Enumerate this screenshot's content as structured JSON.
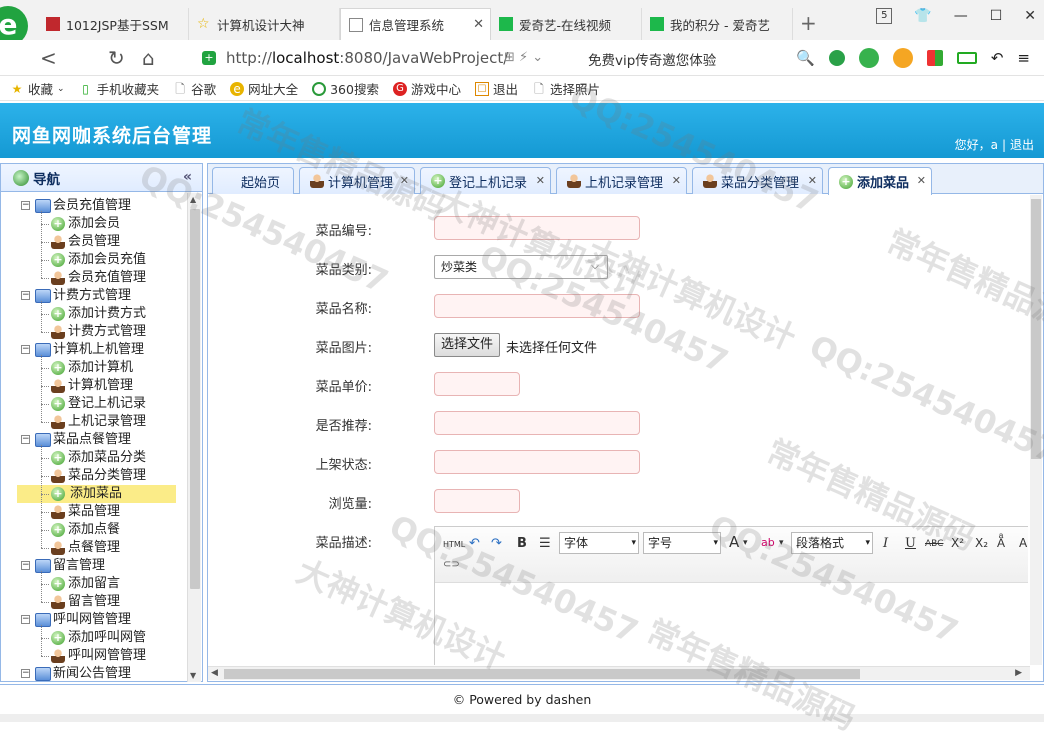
{
  "browser": {
    "tabs": [
      {
        "title": "1012JSP基于SSM",
        "active": false
      },
      {
        "title": "计算机设计大神",
        "active": false
      },
      {
        "title": "信息管理系统",
        "active": true
      },
      {
        "title": "爱奇艺-在线视频",
        "active": false
      },
      {
        "title": "我的积分 - 爱奇艺",
        "active": false
      }
    ],
    "tab_counter": "5",
    "url_prefix": "http://",
    "url_host": "localhost",
    "url_rest": ":8080/JavaWebProject/",
    "promo": "免费vip传奇邀您体验"
  },
  "bookmarks": [
    {
      "label": "收藏",
      "icon": "star-icon"
    },
    {
      "label": "手机收藏夹",
      "icon": "phone-icon"
    },
    {
      "label": "谷歌",
      "icon": "page-icon"
    },
    {
      "label": "网址大全",
      "icon": "globe-icon"
    },
    {
      "label": "360搜索",
      "icon": "search-360-icon"
    },
    {
      "label": "游戏中心",
      "icon": "game-icon"
    },
    {
      "label": "退出",
      "icon": "exit-icon"
    },
    {
      "label": "选择照片",
      "icon": "page-icon"
    }
  ],
  "app": {
    "title": "网鱼网咖系统后台管理",
    "greeting": "您好，a",
    "sep": "|",
    "logout": "退出"
  },
  "nav": {
    "title": "导航",
    "collapse": "«",
    "groups": [
      {
        "label": "会员充值管理",
        "items": [
          {
            "label": "添加会员",
            "icon": "add"
          },
          {
            "label": "会员管理",
            "icon": "user"
          },
          {
            "label": "添加会员充值",
            "icon": "add"
          },
          {
            "label": "会员充值管理",
            "icon": "user"
          }
        ]
      },
      {
        "label": "计费方式管理",
        "items": [
          {
            "label": "添加计费方式",
            "icon": "add"
          },
          {
            "label": "计费方式管理",
            "icon": "user"
          }
        ]
      },
      {
        "label": "计算机上机管理",
        "items": [
          {
            "label": "添加计算机",
            "icon": "add"
          },
          {
            "label": "计算机管理",
            "icon": "user"
          },
          {
            "label": "登记上机记录",
            "icon": "add"
          },
          {
            "label": "上机记录管理",
            "icon": "user"
          }
        ]
      },
      {
        "label": "菜品点餐管理",
        "items": [
          {
            "label": "添加菜品分类",
            "icon": "add"
          },
          {
            "label": "菜品分类管理",
            "icon": "user"
          },
          {
            "label": "添加菜品",
            "icon": "add",
            "selected": true
          },
          {
            "label": "菜品管理",
            "icon": "user"
          },
          {
            "label": "添加点餐",
            "icon": "add"
          },
          {
            "label": "点餐管理",
            "icon": "user"
          }
        ]
      },
      {
        "label": "留言管理",
        "items": [
          {
            "label": "添加留言",
            "icon": "add"
          },
          {
            "label": "留言管理",
            "icon": "user"
          }
        ]
      },
      {
        "label": "呼叫网管管理",
        "items": [
          {
            "label": "添加呼叫网管",
            "icon": "add"
          },
          {
            "label": "呼叫网管管理",
            "icon": "user"
          }
        ]
      },
      {
        "label": "新闻公告管理",
        "items": []
      }
    ]
  },
  "main_tabs": [
    {
      "label": "起始页",
      "icon": "",
      "closable": false
    },
    {
      "label": "计算机管理",
      "icon": "user",
      "closable": true
    },
    {
      "label": "登记上机记录",
      "icon": "add",
      "closable": true
    },
    {
      "label": "上机记录管理",
      "icon": "user",
      "closable": true
    },
    {
      "label": "菜品分类管理",
      "icon": "user",
      "closable": true
    },
    {
      "label": "添加菜品",
      "icon": "add",
      "closable": true,
      "active": true
    }
  ],
  "form": {
    "code_label": "菜品编号:",
    "code_value": "",
    "category_label": "菜品类别:",
    "category_value": "炒菜类",
    "name_label": "菜品名称:",
    "name_value": "",
    "photo_label": "菜品图片:",
    "photo_button": "选择文件",
    "photo_status": "未选择任何文件",
    "price_label": "菜品单价:",
    "price_value": "",
    "recommend_label": "是否推荐:",
    "recommend_value": "",
    "status_label": "上架状态:",
    "status_value": "",
    "views_label": "浏览量:",
    "views_value": "",
    "desc_label": "菜品描述:"
  },
  "editor": {
    "html_label": "HTML",
    "bold": "B",
    "font_select": "字体",
    "size_select": "字号",
    "font_color": "A",
    "paragraph_select": "段落格式",
    "italic": "I",
    "underline": "U",
    "strike": "ABC",
    "superscript": "X²",
    "subscript": "X₂"
  },
  "footer": {
    "text": "© Powered by dashen"
  },
  "watermarks": [
    "QQ:254540457",
    "常年售精品源码",
    "大神计算机设计"
  ],
  "colors": {
    "header": "#1ea6e0",
    "panel_border": "#95b8e7",
    "selected": "#fbec88"
  }
}
